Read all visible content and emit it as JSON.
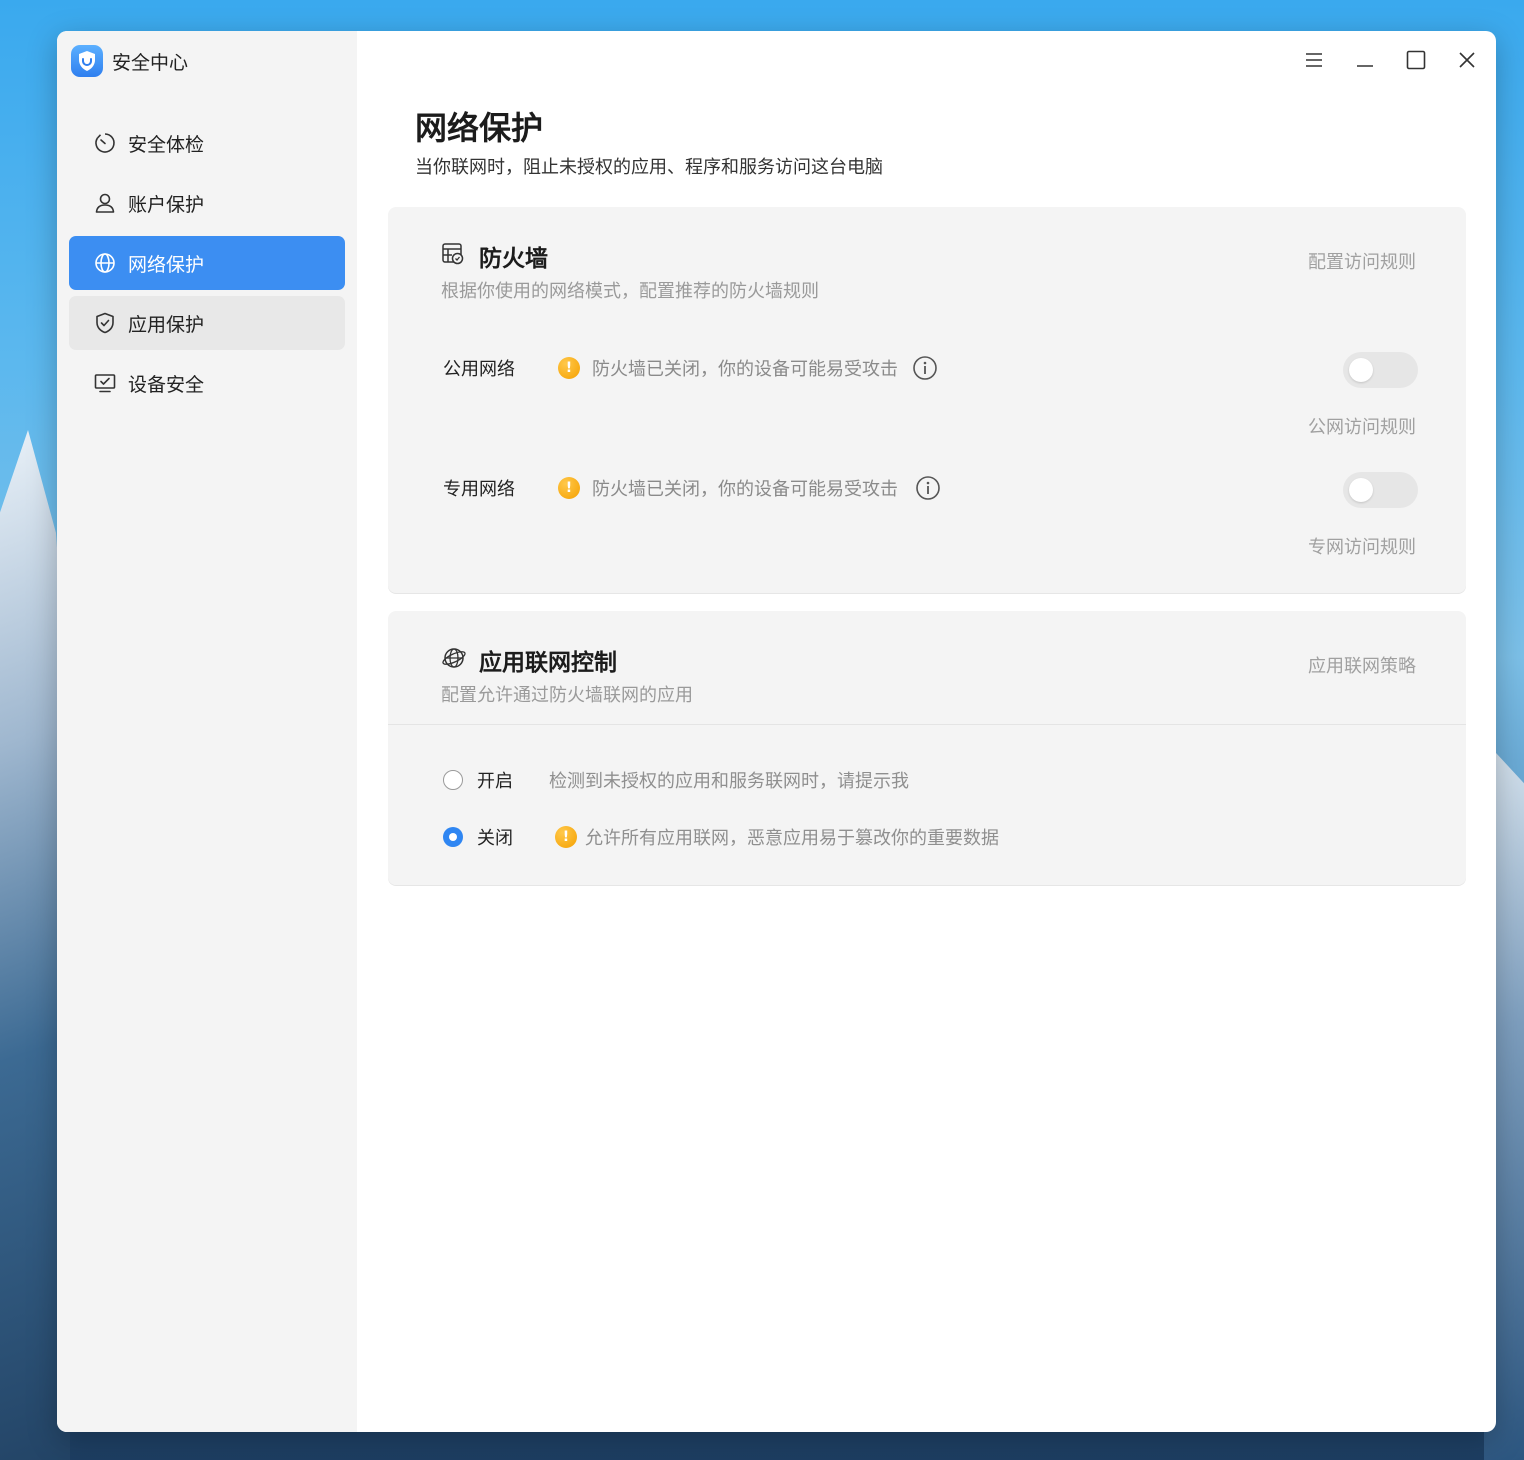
{
  "app": {
    "title": "安全中心"
  },
  "sidebar": {
    "items": [
      {
        "label": "安全体检",
        "icon": "scan-icon"
      },
      {
        "label": "账户保护",
        "icon": "user-icon"
      },
      {
        "label": "网络保护",
        "icon": "globe-icon",
        "active": true
      },
      {
        "label": "应用保护",
        "icon": "shield-check-icon"
      },
      {
        "label": "设备安全",
        "icon": "monitor-check-icon"
      }
    ]
  },
  "window_controls": [
    "menu-icon",
    "minimize-icon",
    "maximize-icon",
    "close-icon"
  ],
  "page": {
    "title": "网络保护",
    "subtitle": "当你联网时，阻止未授权的应用、程序和服务访问这台电脑"
  },
  "firewall": {
    "title": "防火墙",
    "desc": "根据你使用的网络模式，配置推荐的防火墙规则",
    "link": "配置访问规则",
    "networks": [
      {
        "label": "公用网络",
        "status": "防火墙已关闭，你的设备可能易受攻击",
        "toggle": false,
        "link": "公网访问规则"
      },
      {
        "label": "专用网络",
        "status": "防火墙已关闭，你的设备可能易受攻击",
        "toggle": false,
        "link": "专网访问规则"
      }
    ],
    "warn_glyph": "!"
  },
  "app_control": {
    "title": "应用联网控制",
    "desc": "配置允许通过防火墙联网的应用",
    "link": "应用联网策略",
    "options": [
      {
        "label": "开启",
        "desc": "检测到未授权的应用和服务联网时，请提示我",
        "selected": false
      },
      {
        "label": "关闭",
        "desc": "允许所有应用联网，恶意应用易于篡改你的重要数据",
        "selected": true,
        "warning": true
      }
    ]
  },
  "colors": {
    "accent": "#3c8ef2",
    "warning": "#f5a000"
  }
}
